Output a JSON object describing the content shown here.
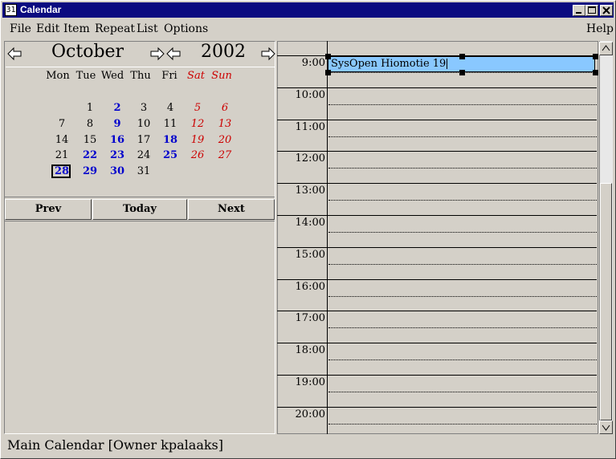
{
  "window": {
    "title": "Calendar",
    "icon": "calendar-app-icon"
  },
  "menu": {
    "items": [
      "File",
      "Edit",
      "Item",
      "Repeat",
      "List",
      "Options"
    ],
    "help": "Help"
  },
  "calendar": {
    "month": "October",
    "year": "2002",
    "weekdays": [
      "Mon",
      "Tue",
      "Wed",
      "Thu",
      "Fri",
      "Sat",
      "Sun"
    ],
    "days": [
      {
        "d": "1",
        "col": 1,
        "row": 0,
        "style": "normal"
      },
      {
        "d": "2",
        "col": 2,
        "row": 0,
        "style": "bold"
      },
      {
        "d": "3",
        "col": 3,
        "row": 0,
        "style": "normal"
      },
      {
        "d": "4",
        "col": 4,
        "row": 0,
        "style": "normal"
      },
      {
        "d": "5",
        "col": 5,
        "row": 0,
        "style": "we"
      },
      {
        "d": "6",
        "col": 6,
        "row": 0,
        "style": "we"
      },
      {
        "d": "7",
        "col": 0,
        "row": 1,
        "style": "normal"
      },
      {
        "d": "8",
        "col": 1,
        "row": 1,
        "style": "normal"
      },
      {
        "d": "9",
        "col": 2,
        "row": 1,
        "style": "bold"
      },
      {
        "d": "10",
        "col": 3,
        "row": 1,
        "style": "normal"
      },
      {
        "d": "11",
        "col": 4,
        "row": 1,
        "style": "normal"
      },
      {
        "d": "12",
        "col": 5,
        "row": 1,
        "style": "we"
      },
      {
        "d": "13",
        "col": 6,
        "row": 1,
        "style": "we"
      },
      {
        "d": "14",
        "col": 0,
        "row": 2,
        "style": "normal"
      },
      {
        "d": "15",
        "col": 1,
        "row": 2,
        "style": "normal"
      },
      {
        "d": "16",
        "col": 2,
        "row": 2,
        "style": "bold"
      },
      {
        "d": "17",
        "col": 3,
        "row": 2,
        "style": "normal"
      },
      {
        "d": "18",
        "col": 4,
        "row": 2,
        "style": "bold"
      },
      {
        "d": "19",
        "col": 5,
        "row": 2,
        "style": "we"
      },
      {
        "d": "20",
        "col": 6,
        "row": 2,
        "style": "we"
      },
      {
        "d": "21",
        "col": 0,
        "row": 3,
        "style": "normal"
      },
      {
        "d": "22",
        "col": 1,
        "row": 3,
        "style": "bold"
      },
      {
        "d": "23",
        "col": 2,
        "row": 3,
        "style": "bold"
      },
      {
        "d": "24",
        "col": 3,
        "row": 3,
        "style": "normal"
      },
      {
        "d": "25",
        "col": 4,
        "row": 3,
        "style": "bold"
      },
      {
        "d": "26",
        "col": 5,
        "row": 3,
        "style": "we"
      },
      {
        "d": "27",
        "col": 6,
        "row": 3,
        "style": "we"
      },
      {
        "d": "28",
        "col": 0,
        "row": 4,
        "style": "today"
      },
      {
        "d": "29",
        "col": 1,
        "row": 4,
        "style": "bold"
      },
      {
        "d": "30",
        "col": 2,
        "row": 4,
        "style": "bold"
      },
      {
        "d": "31",
        "col": 3,
        "row": 4,
        "style": "normal"
      }
    ],
    "nav": {
      "prev": "Prev",
      "today": "Today",
      "next": "Next"
    }
  },
  "timeline": {
    "hours": [
      "9:00",
      "10:00",
      "11:00",
      "12:00",
      "13:00",
      "14:00",
      "15:00",
      "16:00",
      "17:00",
      "18:00",
      "19:00",
      "20:00"
    ],
    "event": {
      "text": "SysOpen Hiomotie 19",
      "color": "#89c8ff"
    }
  },
  "status": "Main Calendar [Owner kpalaaks]"
}
